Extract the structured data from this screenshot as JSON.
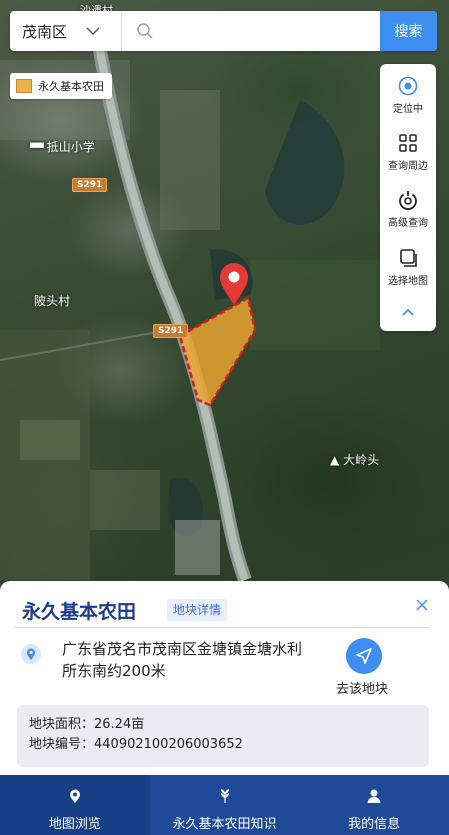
{
  "search": {
    "district": "茂南区",
    "placeholder": "",
    "button_label": "搜索",
    "partial_map_label": "沙遗村"
  },
  "legend": {
    "label": "永久基本农田",
    "color": "#e9b349"
  },
  "toolbar": {
    "items": [
      {
        "label": "定位中",
        "icon": "locate-icon"
      },
      {
        "label": "查询周边",
        "icon": "grid-icon"
      },
      {
        "label": "高级查询",
        "icon": "power-icon"
      },
      {
        "label": "选择地图",
        "icon": "layers-icon"
      }
    ],
    "collapse_icon": "chevron-up-icon"
  },
  "map": {
    "labels": {
      "school": "抵山小学",
      "village": "陂头村",
      "peak": "大岭头"
    },
    "road_shields": [
      "S291",
      "S291"
    ],
    "parcel_color": "#e9a531"
  },
  "panel": {
    "title": "永久基本农田",
    "detail_tag": "地块详情",
    "address": "广东省茂名市茂南区金塘镇金塘水利所东南约200米",
    "goto_label": "去该地块",
    "area": "地块面积：26.24亩",
    "code": "地块编号：440902100206003652"
  },
  "nav": {
    "items": [
      {
        "label": "地图浏览",
        "icon": "map-browse-icon"
      },
      {
        "label": "永久基本农田知识",
        "icon": "wheat-icon"
      },
      {
        "label": "我的信息",
        "icon": "user-icon"
      }
    ]
  },
  "colors": {
    "accent": "#3d8ef0",
    "nav_bg": "#1e4a97",
    "title": "#1a3a8c"
  }
}
